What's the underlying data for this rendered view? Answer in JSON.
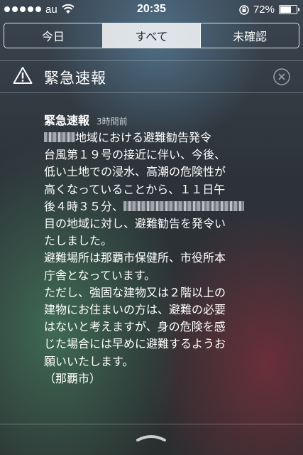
{
  "status_bar": {
    "signal_dots": 5,
    "carrier": "au",
    "time": "20:35",
    "battery_percent": "72%",
    "battery_level": 0.72
  },
  "tabs": [
    {
      "label": "今日",
      "active": false
    },
    {
      "label": "すべて",
      "active": true
    },
    {
      "label": "未確認",
      "active": false
    }
  ],
  "section": {
    "title": "緊急速報",
    "icon": "warning-triangle-icon",
    "close_icon": "close-circle-icon"
  },
  "notification": {
    "title": "緊急速報",
    "time": "3時間前",
    "lines": [
      "地域における避難勧告発令",
      "台風第１９号の接近に伴い、今後、",
      "低い土地での浸水、高潮の危険性が",
      "高くなっていることから、１１日午",
      "後４時３５分、",
      "目の地域に対し、避難勧告を発令い",
      "たしました。",
      "避難場所は那覇市保健所、市役所本",
      "庁舎となっています。",
      "ただし、強固な建物又は２階以上の",
      "建物にお住まいの方は、避難の必要",
      "はないと考えますが、身の危険を感",
      "じた場合には早めに避難するようお",
      "願いいたします。",
      "（那覇市）"
    ]
  },
  "colors": {
    "accent_active_tab_bg": "#d1d4d6",
    "text": "#ffffff"
  }
}
